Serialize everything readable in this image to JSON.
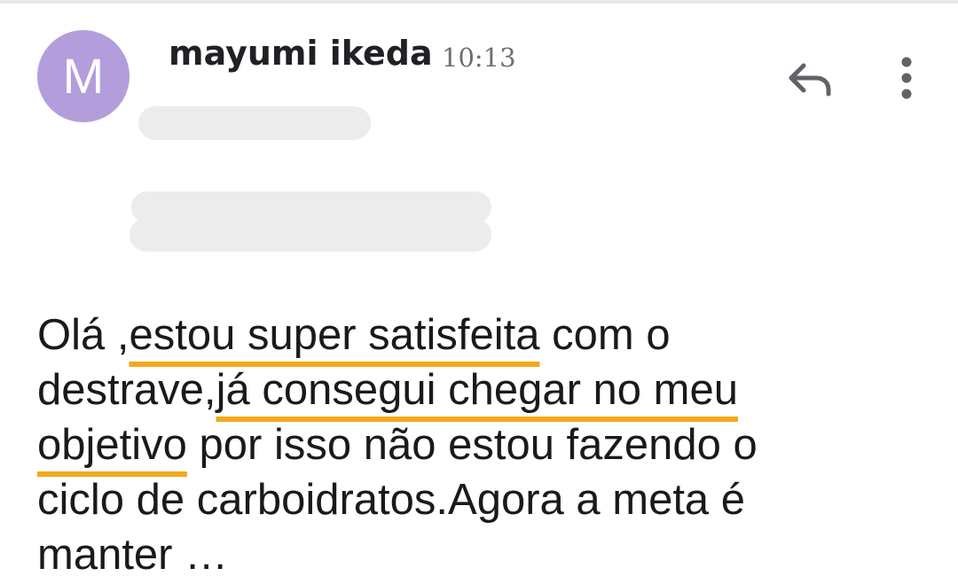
{
  "message": {
    "avatar_letter": "M",
    "avatar_color": "#b39ddb",
    "sender_name": "mayumi ikeda",
    "time": "10:13",
    "actions": {
      "reply_icon": "reply-icon",
      "more_icon": "more-vert-icon"
    },
    "highlight_color": "#f2a91c",
    "body": {
      "line1_pre": "Olá ,",
      "line1_hl": "estou super satisfeita",
      "line1_post": " com o",
      "line2_pre": "destrave,",
      "line2_hl": "já consegui chegar no meu",
      "line3_hl": "objetivo",
      "line3_post": " por isso não estou fazendo o",
      "line4": "ciclo de carboidratos.Agora a meta é",
      "line5": "manter …"
    }
  }
}
